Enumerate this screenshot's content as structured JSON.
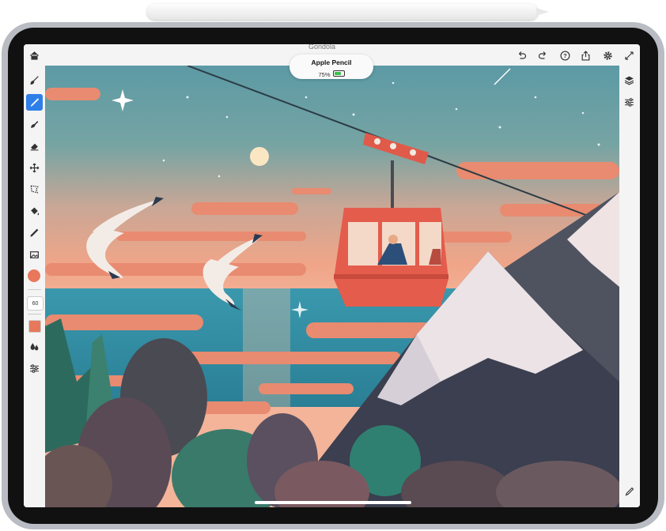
{
  "pencil_popup": {
    "name": "Apple Pencil",
    "battery": "75%",
    "battery_fraction": 0.75,
    "battery_color": "#3bc24a"
  },
  "document_title": "Gondola",
  "topbar": {
    "left_icons": [
      "home-icon"
    ],
    "right_icons": [
      "undo-icon",
      "redo-icon",
      "help-icon",
      "share-icon",
      "settings-icon",
      "fullscreen-icon"
    ]
  },
  "left_toolbar": {
    "tools": [
      "brush-tool-icon",
      "pencil-tool-icon",
      "smudge-tool-icon",
      "eraser-tool-icon",
      "move-tool-icon",
      "selection-tool-icon",
      "fill-tool-icon",
      "eyedropper-tool-icon",
      "image-tool-icon"
    ],
    "active_tool": "pencil-tool-icon",
    "brush_size": "60",
    "brush_color": "#e8785b"
  },
  "right_toolbar": {
    "icons": [
      "layers-icon",
      "adjustments-icon",
      "edit-icon"
    ]
  },
  "colors": {
    "accent": "#2f7fe8",
    "toolbar_bg": "#f4f4f4",
    "device_frame": "#b9bcc2"
  }
}
